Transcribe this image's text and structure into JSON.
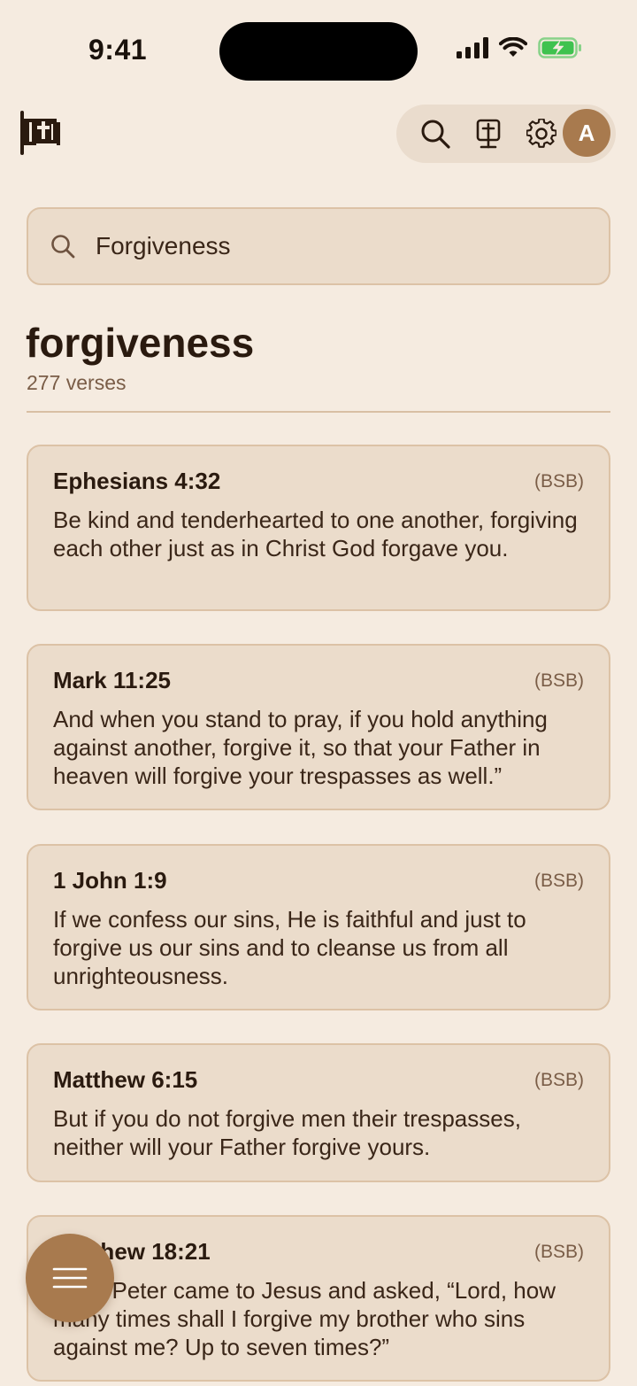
{
  "status_bar": {
    "time": "9:41"
  },
  "header": {
    "logo_icon": "bible-scroll-icon",
    "toolbar": {
      "search_icon": "search-icon",
      "bible_icon": "bible-cross-icon",
      "settings_icon": "gear-icon",
      "avatar_initial": "A"
    }
  },
  "search": {
    "value": "Forgiveness"
  },
  "results": {
    "title": "forgiveness",
    "count": "277 verses",
    "verses": [
      {
        "ref": "Ephesians 4:32",
        "translation": "(BSB)",
        "text": "Be kind and tenderhearted to one another, forgiving each other just as in Christ God forgave you."
      },
      {
        "ref": "Mark 11:25",
        "translation": "(BSB)",
        "text": "And when you stand to pray, if you hold anything against another, forgive it, so that your Father in heaven will forgive your trespasses as well.”"
      },
      {
        "ref": "1 John 1:9",
        "translation": "(BSB)",
        "text": "If we confess our sins, He is faithful and just to forgive us our sins and to cleanse us from all unrighteousness."
      },
      {
        "ref": "Matthew 6:15",
        "translation": "(BSB)",
        "text": "But if you do not forgive men their trespasses, neither will your Father forgive yours."
      },
      {
        "ref": "Matthew 18:21",
        "translation": "(BSB)",
        "text": "Then Peter came to Jesus and asked, “Lord, how many times shall I forgive my brother who sins against me? Up to seven times?”"
      }
    ]
  },
  "fab": {
    "icon": "menu-icon"
  },
  "colors": {
    "accent": "#a87a4e",
    "background": "#f5ebe0",
    "card": "#ebdccb",
    "battery": "#3fc24f"
  }
}
